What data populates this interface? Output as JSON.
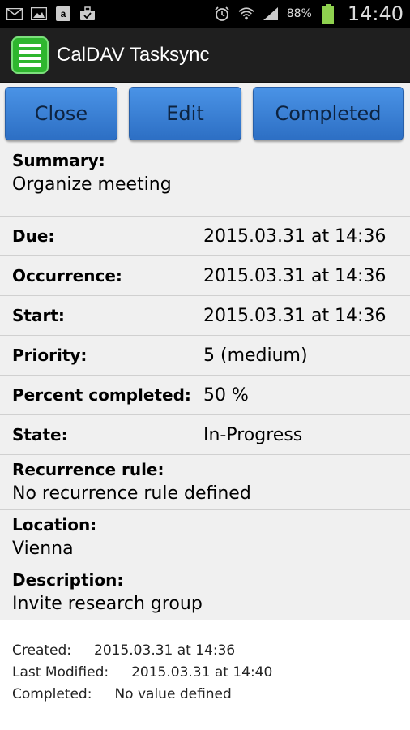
{
  "status_bar": {
    "battery_percent": "88%",
    "time": "14:40",
    "icons_left": [
      "mail-icon",
      "image-icon",
      "amazon-icon",
      "briefcase-icon"
    ],
    "icons_right": [
      "alarm-icon",
      "wifi-icon",
      "signal-icon",
      "battery-icon"
    ]
  },
  "app": {
    "title": "CalDAV Tasksync",
    "icon": "task-list-icon",
    "accent_color": "#2fb62f"
  },
  "buttons": {
    "close": "Close",
    "edit": "Edit",
    "completed": "Completed"
  },
  "task": {
    "summary_label": "Summary:",
    "summary_value": "Organize meeting",
    "fields": [
      {
        "label": "Due:",
        "value": "2015.03.31 at 14:36"
      },
      {
        "label": "Occurrence:",
        "value": "2015.03.31 at 14:36"
      },
      {
        "label": "Start:",
        "value": "2015.03.31 at 14:36"
      },
      {
        "label": "Priority:",
        "value": "5 (medium)"
      },
      {
        "label": "Percent completed:",
        "value": "50 %"
      },
      {
        "label": "State:",
        "value": "In-Progress"
      }
    ],
    "recurrence_label": "Recurrence rule:",
    "recurrence_value": "No recurrence rule defined",
    "location_label": "Location:",
    "location_value": "Vienna",
    "description_label": "Description:",
    "description_value": "Invite research group"
  },
  "footer": {
    "created_label": "Created:",
    "created_value": "2015.03.31 at 14:36",
    "modified_label": "Last Modified:",
    "modified_value": "2015.03.31 at 14:40",
    "completed_label": "Completed:",
    "completed_value": "No value defined"
  }
}
